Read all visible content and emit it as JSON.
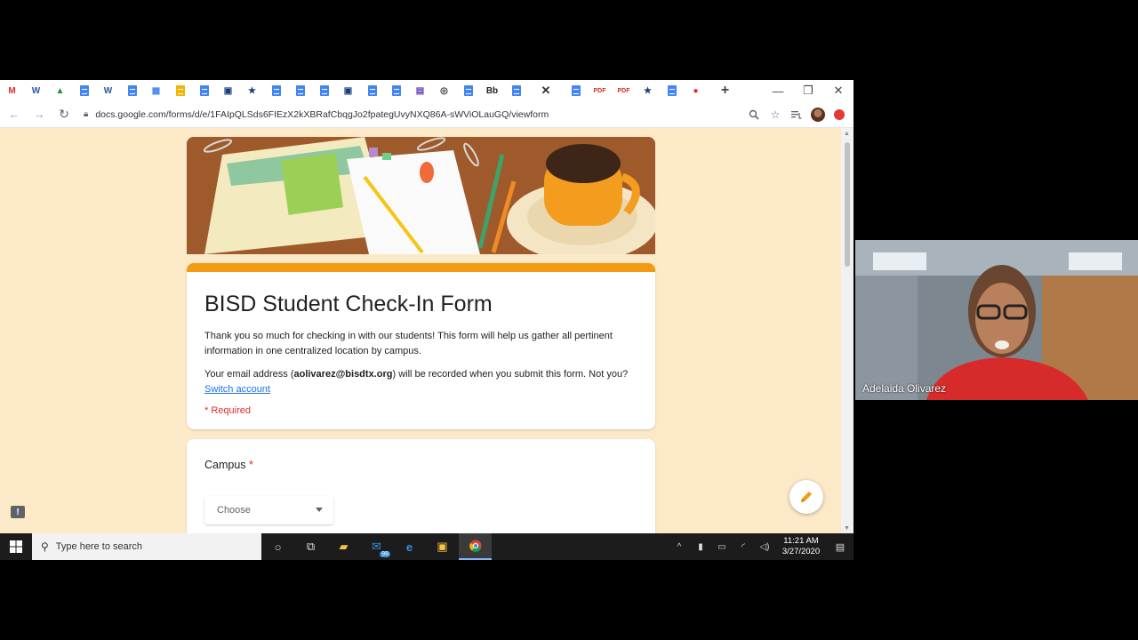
{
  "browser": {
    "url": "docs.google.com/forms/d/e/1FAIpQLSds6FIEzX2kXBRafCbqgJo2fpategUvyNXQ86A-sWViOLauGQ/viewform",
    "tabs": [
      {
        "icon": "gmail-icon",
        "glyph": "M",
        "color": "#d93025"
      },
      {
        "icon": "word-icon",
        "glyph": "W",
        "color": "#2b579a"
      },
      {
        "icon": "drive-icon",
        "glyph": "▲",
        "color": "#1e8e3e"
      },
      {
        "icon": "docs-icon",
        "glyph": "",
        "color": "#4285f4"
      },
      {
        "icon": "word-icon",
        "glyph": "W",
        "color": "#2b579a"
      },
      {
        "icon": "docs-icon",
        "glyph": "",
        "color": "#4285f4"
      },
      {
        "icon": "calendar-icon",
        "glyph": "▦",
        "color": "#4285f4"
      },
      {
        "icon": "slides-icon",
        "glyph": "",
        "color": "#f4b400"
      },
      {
        "icon": "docs-icon",
        "glyph": "",
        "color": "#4285f4"
      },
      {
        "icon": "app-icon",
        "glyph": "▣",
        "color": "#1a3c78"
      },
      {
        "icon": "bookmark-star-icon",
        "glyph": "★",
        "color": "#1a3c78"
      },
      {
        "icon": "docs-icon",
        "glyph": "",
        "color": "#4285f4"
      },
      {
        "icon": "docs-icon",
        "glyph": "",
        "color": "#4285f4"
      },
      {
        "icon": "docs-icon",
        "glyph": "",
        "color": "#4285f4"
      },
      {
        "icon": "app-icon",
        "glyph": "▣",
        "color": "#1a3c78"
      },
      {
        "icon": "docs-icon",
        "glyph": "",
        "color": "#4285f4"
      },
      {
        "icon": "docs-icon",
        "glyph": "",
        "color": "#4285f4"
      },
      {
        "icon": "forms-icon",
        "glyph": "▤",
        "color": "#673ab7"
      },
      {
        "icon": "chrome-icon",
        "glyph": "◎",
        "color": "#333333"
      },
      {
        "icon": "docs-icon",
        "glyph": "",
        "color": "#4285f4"
      },
      {
        "icon": "blackboard-icon",
        "glyph": "Bb",
        "color": "#222222"
      },
      {
        "icon": "docs-icon",
        "glyph": "",
        "color": "#4285f4"
      }
    ],
    "tabs_after": [
      {
        "icon": "docs-icon",
        "glyph": "",
        "color": "#4285f4"
      },
      {
        "icon": "pdf-icon",
        "glyph": "PDF",
        "color": "#d93025"
      },
      {
        "icon": "pdf-icon",
        "glyph": "PDF",
        "color": "#d93025"
      },
      {
        "icon": "bookmark-star-icon",
        "glyph": "★",
        "color": "#1a3c78"
      },
      {
        "icon": "docs-icon",
        "glyph": "",
        "color": "#4285f4"
      },
      {
        "icon": "record-icon",
        "glyph": "●",
        "color": "#d93025"
      }
    ]
  },
  "form": {
    "title": "BISD Student Check-In Form",
    "description": "Thank you so much for checking in with our students!  This form will help us gather all pertinent information in one centralized location by campus.",
    "email_prefix": "Your email address (",
    "email": "aolivarez@bisdtx.org",
    "email_suffix": ") will be recorded when you submit this form. Not you? ",
    "switch_account": "Switch account",
    "required_note": "* Required",
    "accent_color": "#f29b12",
    "background_color": "#fbe9c8"
  },
  "question": {
    "label": "Campus",
    "required_mark": "*",
    "select_value": "Choose"
  },
  "taskbar": {
    "search_placeholder": "Type here to search",
    "mail_badge": "98",
    "time": "11:21 AM",
    "date": "3/27/2020"
  },
  "webcam": {
    "name": "Adelaida Olivarez"
  }
}
